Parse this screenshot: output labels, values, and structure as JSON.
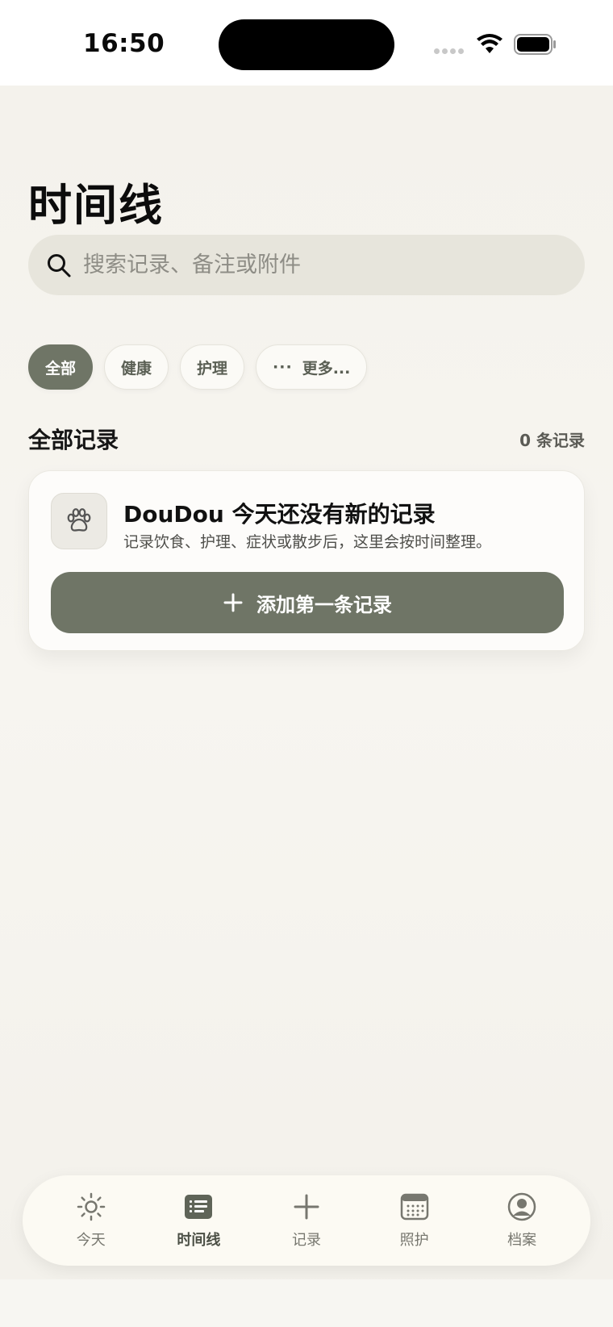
{
  "status_bar": {
    "time": "16:50"
  },
  "page": {
    "title": "时间线"
  },
  "search": {
    "placeholder": "搜索记录、备注或附件"
  },
  "filters": [
    {
      "label": "全部",
      "active": true
    },
    {
      "label": "健康",
      "active": false
    },
    {
      "label": "护理",
      "active": false
    },
    {
      "label": "更多...",
      "prefix": "···",
      "active": false
    }
  ],
  "section": {
    "title": "全部记录",
    "count": "0 条记录"
  },
  "empty_card": {
    "icon": "paw-icon",
    "title": "DouDou 今天还没有新的记录",
    "subtitle": "记录饮食、护理、症状或散步后，这里会按时间整理。",
    "button_label": "添加第一条记录",
    "button_icon": "plus-icon"
  },
  "tabbar": [
    {
      "label": "今天",
      "icon": "sun-icon",
      "active": false
    },
    {
      "label": "时间线",
      "icon": "list-icon",
      "active": true
    },
    {
      "label": "记录",
      "icon": "plus-icon",
      "active": false
    },
    {
      "label": "照护",
      "icon": "calendar-icon",
      "active": false
    },
    {
      "label": "档案",
      "icon": "person-circle-icon",
      "active": false
    }
  ],
  "colors": {
    "accent": "#6f7566",
    "background": "#f5f3ee",
    "search_bg": "#e7e5dc",
    "tabbar_bg": "#fcfaf3"
  }
}
